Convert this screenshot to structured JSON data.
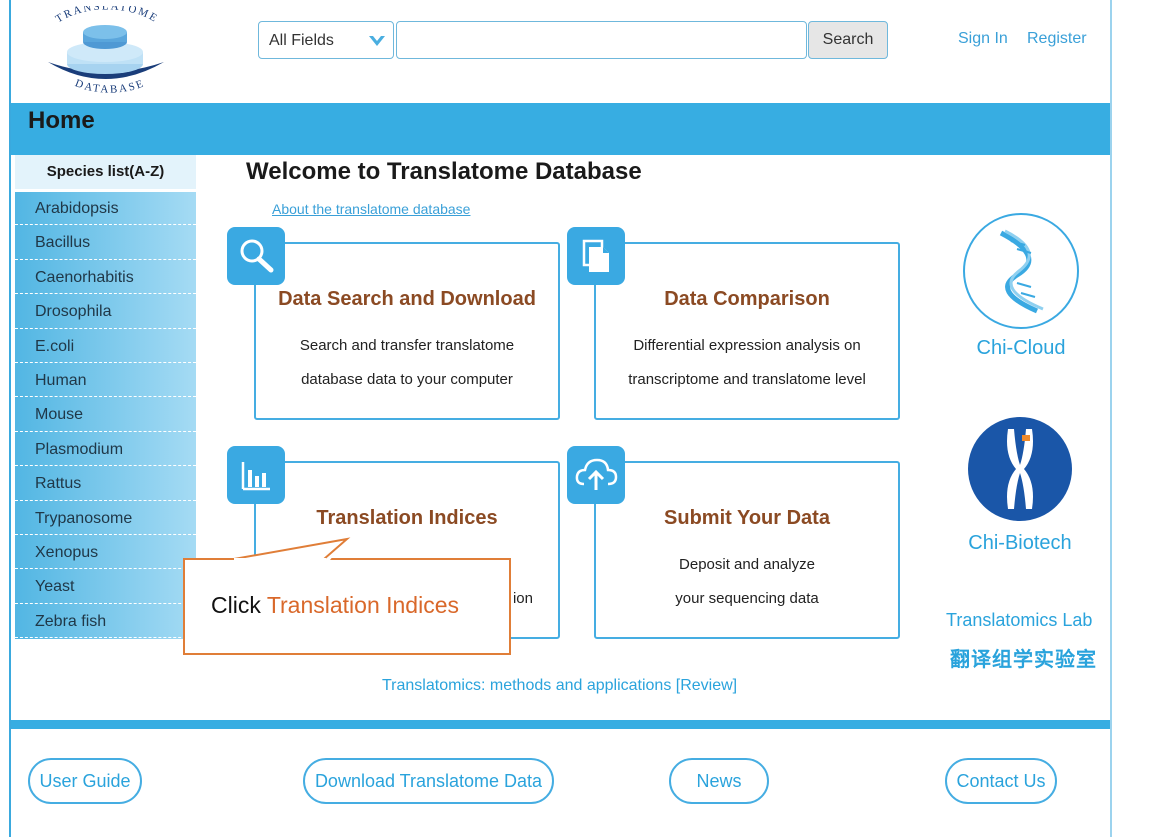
{
  "header": {
    "logo_text_top": "TRANSLATOME",
    "logo_text_bottom": "DATABASE",
    "search_scope": "All Fields",
    "search_value": "",
    "search_button": "Search",
    "sign_in": "Sign In",
    "register": "Register"
  },
  "home": {
    "title": "Home"
  },
  "sidebar": {
    "title": "Species list(A-Z)",
    "items": [
      "Arabidopsis",
      "Bacillus",
      "Caenorhabitis",
      "Drosophila",
      "E.coli",
      "Human",
      "Mouse",
      "Plasmodium",
      "Rattus",
      "Trypanosome",
      "Xenopus",
      "Yeast",
      "Zebra fish"
    ]
  },
  "main": {
    "welcome": "Welcome to Translatome Database",
    "about_link": "About the translatome database",
    "cards": [
      {
        "title": "Data Search and Download",
        "line1": "Search and transfer translatome",
        "line2": "database data to your computer",
        "icon": "search-icon"
      },
      {
        "title": "Data Comparison",
        "line1": "Differential expression analysis on",
        "line2": "transcriptome and translatome level",
        "icon": "document-icon"
      },
      {
        "title": "Translation Indices",
        "line1": "",
        "line2": "ion",
        "icon": "bar-chart-icon"
      },
      {
        "title": "Submit Your Data",
        "line1": "Deposit and analyze",
        "line2": "your sequencing data",
        "icon": "cloud-upload-icon"
      }
    ],
    "review_link": "Translatomics: methods and applications [Review]"
  },
  "right": {
    "chi_cloud": "Chi-Cloud",
    "chi_biotech": "Chi-Biotech",
    "lab_en": "Translatomics Lab",
    "lab_cn": "翻译组学实验室"
  },
  "footer": {
    "user_guide": "User Guide",
    "download": "Download Translatome Data",
    "news": "News",
    "contact": "Contact Us"
  },
  "callout": {
    "prefix": "Click ",
    "highlight": "Translation Indices"
  },
  "colors": {
    "accent": "#37ade2",
    "card_title": "#8b4a23",
    "callout_border": "#e07e38"
  }
}
